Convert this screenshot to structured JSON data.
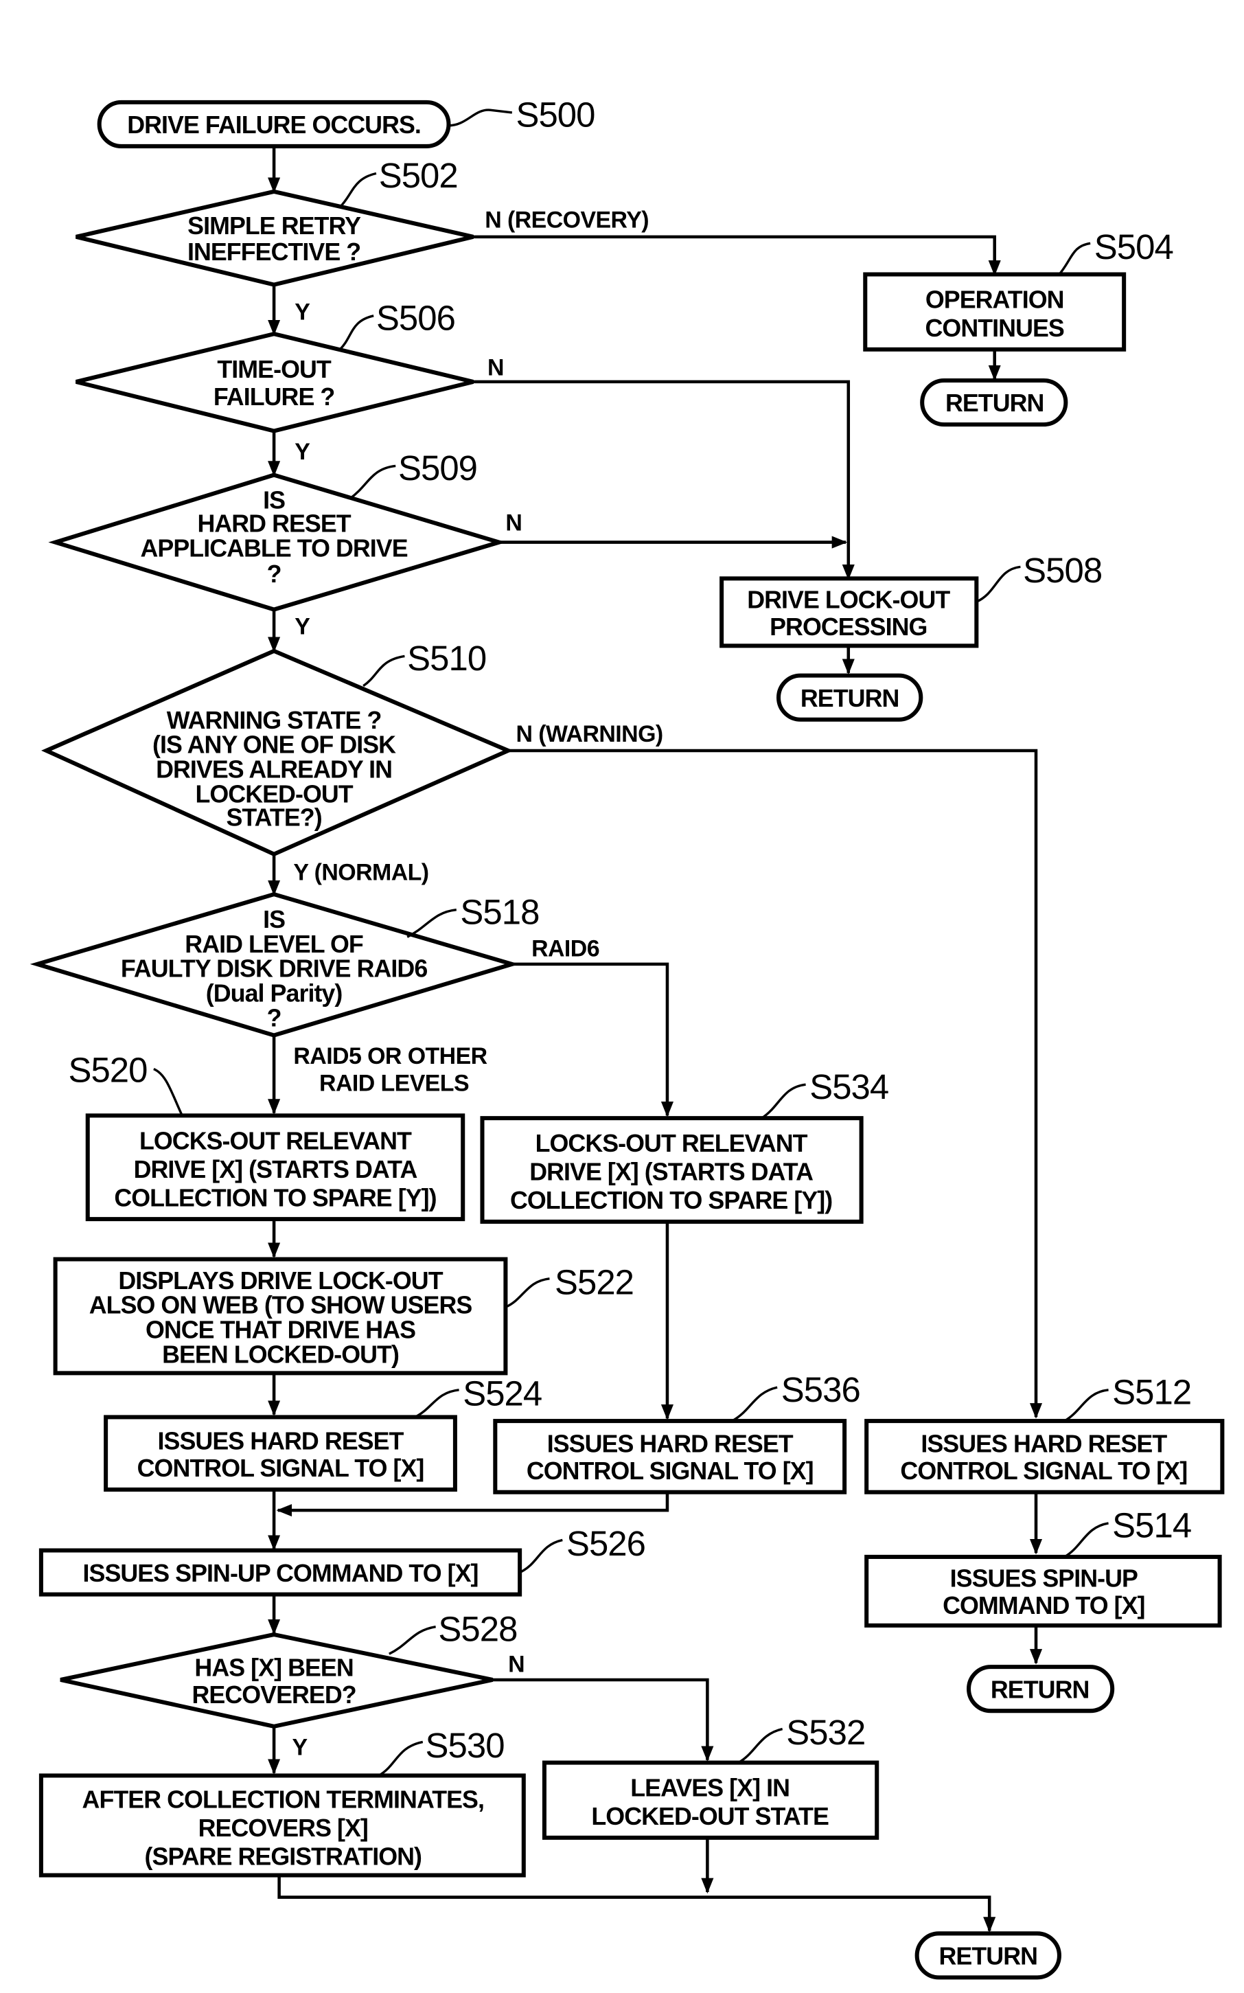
{
  "nodes": {
    "s500": {
      "step": "S500",
      "lines": [
        "DRIVE FAILURE OCCURS."
      ]
    },
    "s502": {
      "step": "S502",
      "lines": [
        "SIMPLE RETRY",
        "INEFFECTIVE ?"
      ]
    },
    "s504": {
      "step": "S504",
      "lines": [
        "OPERATION",
        "CONTINUES"
      ]
    },
    "s506": {
      "step": "S506",
      "lines": [
        "TIME-OUT",
        "FAILURE ?"
      ]
    },
    "s509": {
      "step": "S509",
      "lines": [
        "IS",
        "HARD RESET",
        "APPLICABLE TO DRIVE",
        "?"
      ]
    },
    "s508": {
      "step": "S508",
      "lines": [
        "DRIVE LOCK-OUT",
        "PROCESSING"
      ]
    },
    "s510": {
      "step": "S510",
      "lines": [
        "WARNING STATE ?",
        "(IS ANY ONE OF DISK",
        "DRIVES ALREADY IN",
        "LOCKED-OUT",
        "STATE?)"
      ]
    },
    "s518": {
      "step": "S518",
      "lines": [
        "IS",
        "RAID LEVEL OF",
        "FAULTY DISK DRIVE RAID6",
        "(Dual Parity)",
        "?"
      ]
    },
    "s520": {
      "step": "S520",
      "lines": [
        "LOCKS-OUT RELEVANT",
        "DRIVE [X] (STARTS DATA",
        "COLLECTION TO SPARE [Y])"
      ]
    },
    "s534": {
      "step": "S534",
      "lines": [
        "LOCKS-OUT RELEVANT",
        "DRIVE [X] (STARTS DATA",
        "COLLECTION TO SPARE [Y])"
      ]
    },
    "s522": {
      "step": "S522",
      "lines": [
        "DISPLAYS DRIVE LOCK-OUT",
        "ALSO ON WEB (TO SHOW USERS",
        "ONCE THAT DRIVE HAS",
        "BEEN LOCKED-OUT)"
      ]
    },
    "s524": {
      "step": "S524",
      "lines": [
        "ISSUES HARD RESET",
        "CONTROL SIGNAL TO [X]"
      ]
    },
    "s536": {
      "step": "S536",
      "lines": [
        "ISSUES HARD RESET",
        "CONTROL SIGNAL TO [X]"
      ]
    },
    "s512": {
      "step": "S512",
      "lines": [
        "ISSUES HARD RESET",
        "CONTROL SIGNAL TO [X]"
      ]
    },
    "s526": {
      "step": "S526",
      "lines": [
        "ISSUES SPIN-UP COMMAND TO [X]"
      ]
    },
    "s514": {
      "step": "S514",
      "lines": [
        "ISSUES SPIN-UP",
        "COMMAND TO [X]"
      ]
    },
    "s528": {
      "step": "S528",
      "lines": [
        "HAS [X] BEEN",
        "RECOVERED?"
      ]
    },
    "s530": {
      "step": "S530",
      "lines": [
        "AFTER COLLECTION TERMINATES,",
        "RECOVERS [X]",
        "(SPARE REGISTRATION)"
      ]
    },
    "s532": {
      "step": "S532",
      "lines": [
        "LEAVES [X] IN",
        "LOCKED-OUT STATE"
      ]
    }
  },
  "terminals": {
    "return_504": "RETURN",
    "return_508": "RETURN",
    "return_514": "RETURN",
    "return_end": "RETURN"
  },
  "edge_labels": {
    "s502_n": "N (RECOVERY)",
    "s502_y": "Y",
    "s506_n": "N",
    "s506_y": "Y",
    "s509_n": "N",
    "s509_y": "Y",
    "s510_n": "N (WARNING)",
    "s510_y": "Y (NORMAL)",
    "s518_raid6": "RAID6",
    "s518_other_1": "RAID5 OR OTHER",
    "s518_other_2": "RAID LEVELS",
    "s528_n": "N",
    "s528_y": "Y"
  }
}
